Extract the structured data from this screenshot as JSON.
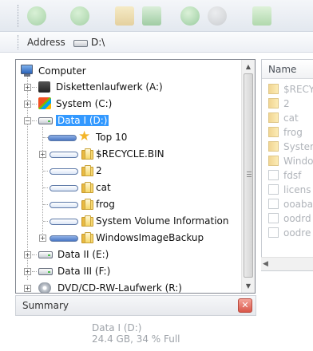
{
  "address": {
    "label": "Address",
    "value": "D:\\"
  },
  "tree": {
    "items": [
      {
        "label": "Computer"
      },
      {
        "label": "Diskettenlaufwerk (A:)"
      },
      {
        "label": "System (C:)"
      },
      {
        "label": "Data I (D:)"
      },
      {
        "label": "Top 10"
      },
      {
        "label": "$RECYCLE.BIN"
      },
      {
        "label": "2"
      },
      {
        "label": "cat"
      },
      {
        "label": "frog"
      },
      {
        "label": "System Volume Information"
      },
      {
        "label": "WindowsImageBackup"
      },
      {
        "label": "Data II (E:)"
      },
      {
        "label": "Data III (F:)"
      },
      {
        "label": "DVD/CD-RW-Laufwerk (R:)"
      }
    ]
  },
  "list": {
    "header": "Name",
    "items": [
      {
        "label": "$RECY",
        "kind": "folder"
      },
      {
        "label": "2",
        "kind": "folder"
      },
      {
        "label": "cat",
        "kind": "folder"
      },
      {
        "label": "frog",
        "kind": "folder"
      },
      {
        "label": "Syster",
        "kind": "folder"
      },
      {
        "label": "Windo",
        "kind": "folder"
      },
      {
        "label": "fdsf",
        "kind": "file"
      },
      {
        "label": "licens",
        "kind": "file"
      },
      {
        "label": "ooaba",
        "kind": "file"
      },
      {
        "label": "oodrd",
        "kind": "file"
      },
      {
        "label": "oodre",
        "kind": "file"
      }
    ]
  },
  "summary": {
    "title": "Summary",
    "close_icon": "close-icon",
    "drive_name": "Data I (D:)",
    "drive_usage": "24.4 GB, 34 % Full"
  },
  "colors": {
    "selection": "#3399ff",
    "close": "#d9574a"
  }
}
